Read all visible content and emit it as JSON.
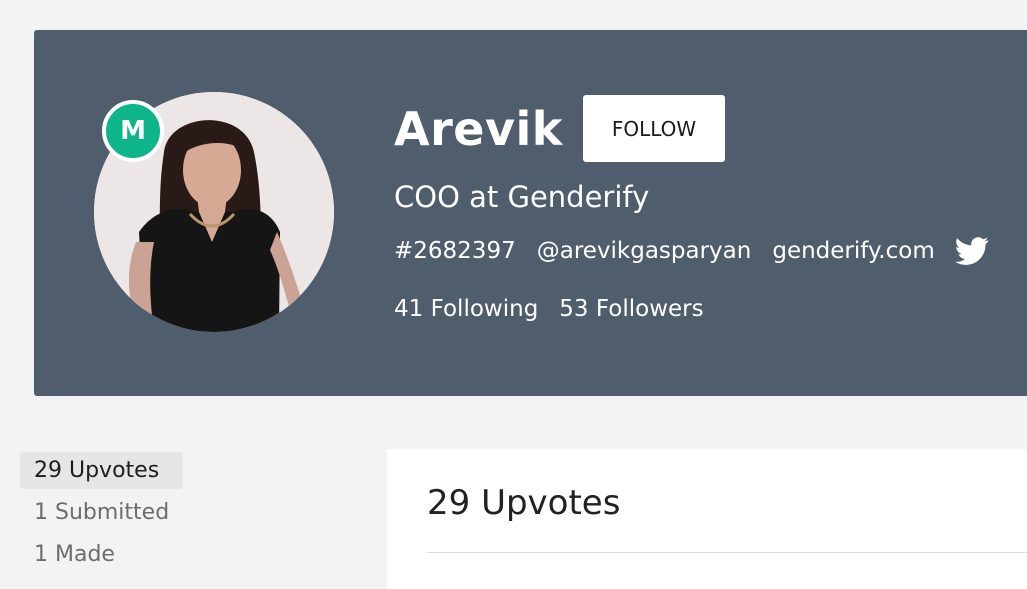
{
  "profile": {
    "name": "Arevik",
    "badge_letter": "M",
    "title": "COO at Genderify",
    "id": "#2682397",
    "handle": "@arevikgasparyan",
    "website": "genderify.com",
    "following": "41 Following",
    "followers": "53 Followers",
    "follow_label": "FOLLOW"
  },
  "sidebar": {
    "items": [
      {
        "label": "29 Upvotes",
        "active": true
      },
      {
        "label": "1 Submitted",
        "active": false
      },
      {
        "label": "1 Made",
        "active": false
      }
    ]
  },
  "main": {
    "heading": "29 Upvotes"
  },
  "colors": {
    "header_bg": "#4f5d6c",
    "badge_green": "#0fb58a",
    "page_bg": "#f3f3f3"
  },
  "icons": {
    "twitter": "twitter-icon"
  }
}
